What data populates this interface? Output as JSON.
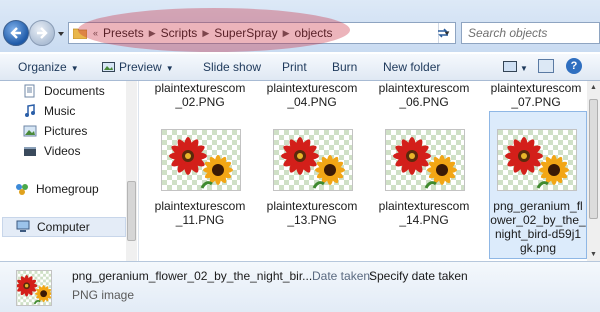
{
  "address_bar": {
    "breadcrumbs": [
      "Presets",
      "Scripts",
      "SuperSpray",
      "objects"
    ],
    "overflow_marker": "«",
    "search_placeholder": "Search objects"
  },
  "toolbar": {
    "organize": "Organize",
    "preview": "Preview",
    "slide_show": "Slide show",
    "print": "Print",
    "burn": "Burn",
    "new_folder": "New folder"
  },
  "nav_pane": {
    "items": [
      {
        "label": "Documents",
        "icon": "documents-icon"
      },
      {
        "label": "Music",
        "icon": "music-icon"
      },
      {
        "label": "Pictures",
        "icon": "pictures-icon"
      },
      {
        "label": "Videos",
        "icon": "videos-icon"
      },
      {
        "label": "Homegroup",
        "icon": "homegroup-icon"
      },
      {
        "label": "Computer",
        "icon": "computer-icon"
      }
    ]
  },
  "files": {
    "top_row": [
      {
        "line1": "plaintexturescom",
        "line2": "_02.PNG"
      },
      {
        "line1": "plaintexturescom",
        "line2": "_04.PNG"
      },
      {
        "line1": "plaintexturescom",
        "line2": "_06.PNG"
      },
      {
        "line1": "plaintexturescom",
        "line2": "_07.PNG"
      }
    ],
    "bottom_row": [
      {
        "line1": "plaintexturescom",
        "line2": "_11.PNG",
        "line3": "",
        "line4": ""
      },
      {
        "line1": "plaintexturescom",
        "line2": "_13.PNG",
        "line3": "",
        "line4": ""
      },
      {
        "line1": "plaintexturescom",
        "line2": "_14.PNG",
        "line3": "",
        "line4": ""
      },
      {
        "line1": "png_geranium_fl",
        "line2": "ower_02_by_the_",
        "line3": "night_bird-d59j1",
        "line4": "gk.png"
      }
    ]
  },
  "details": {
    "file_name": "png_geranium_flower_02_by_the_night_bir...",
    "file_type": "PNG image",
    "date_label": "Date taken:",
    "date_value": "Specify date taken"
  },
  "colors": {
    "highlight": "#c8283c",
    "accent": "#2f6fc0"
  }
}
